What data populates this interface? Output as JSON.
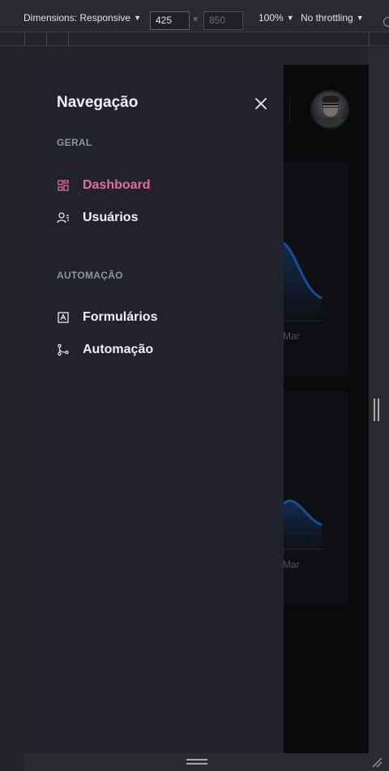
{
  "devtools": {
    "dimensions_label": "Dimensions: Responsive",
    "width_value": "425",
    "height_placeholder": "850",
    "separator": "×",
    "zoom": "100%",
    "throttling": "No throttling",
    "caret": "▼"
  },
  "drawer": {
    "title": "Navegação",
    "sections": [
      {
        "label": "GERAL",
        "items": [
          {
            "label": "Dashboard",
            "icon": "dashboard-icon",
            "active": true
          },
          {
            "label": "Usuários",
            "icon": "users-icon",
            "active": false
          }
        ]
      },
      {
        "label": "AUTOMAÇÃO",
        "items": [
          {
            "label": "Formulários",
            "icon": "form-icon",
            "active": false
          },
          {
            "label": "Automação",
            "icon": "workflow-icon",
            "active": false
          }
        ]
      }
    ]
  },
  "background": {
    "chart_label_1": "Mar",
    "chart_label_2": "Mar"
  },
  "colors": {
    "accent": "#e56aa5",
    "drawer_bg": "#22222d",
    "chart_line": "#1e6fd0"
  }
}
